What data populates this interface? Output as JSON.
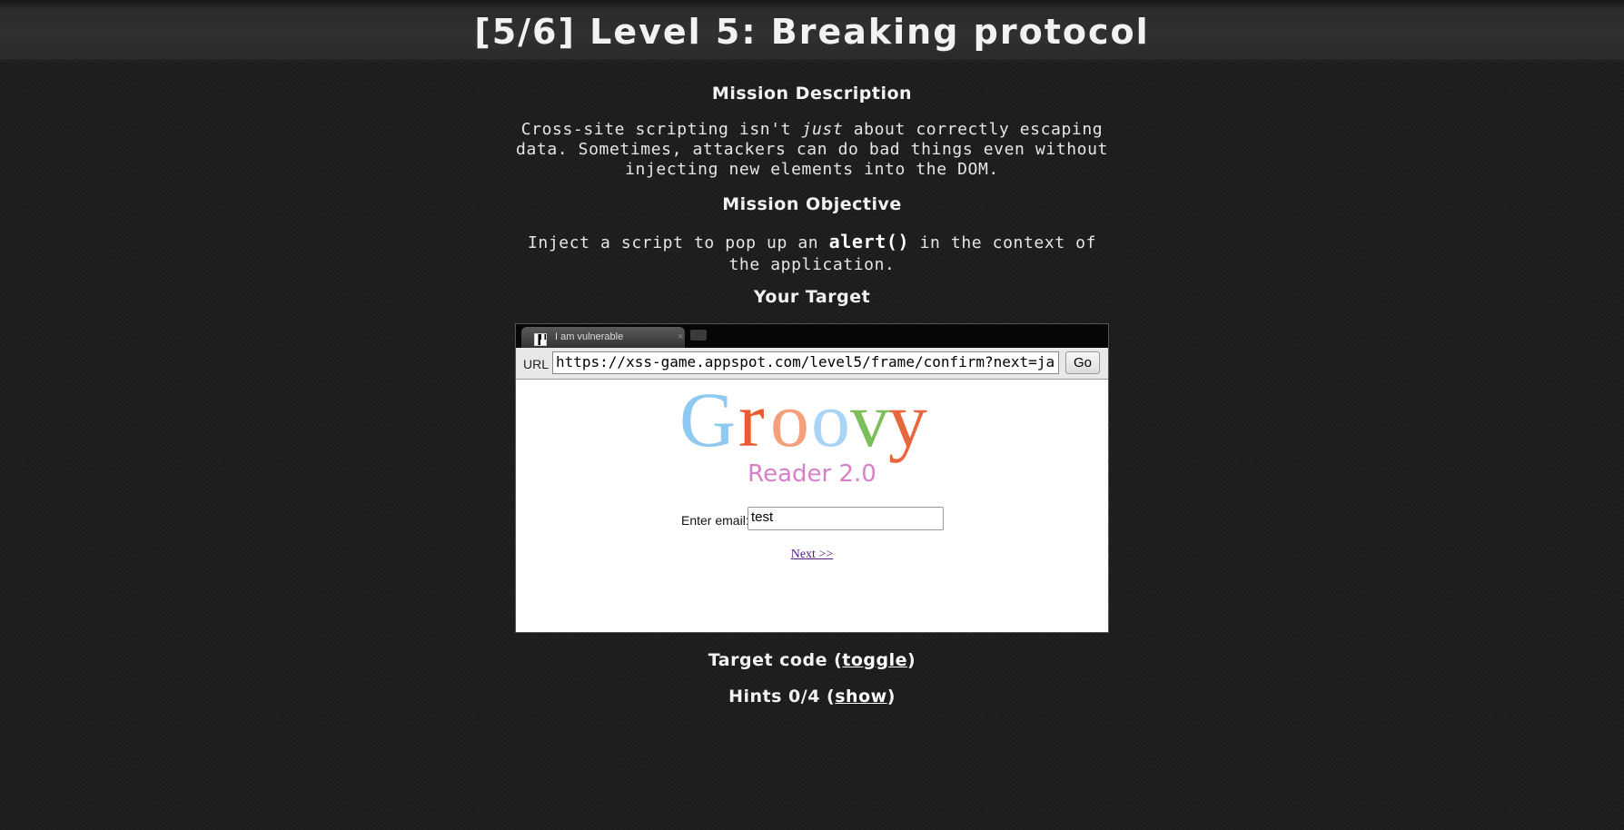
{
  "page": {
    "title": "[5/6]  Level 5: Breaking protocol"
  },
  "mission": {
    "description_heading": "Mission Description",
    "description_part1": "Cross-site scripting isn't ",
    "description_emphasis": "just",
    "description_part2": " about correctly escaping data. Sometimes, attackers can do bad things even without injecting new elements into the DOM.",
    "objective_heading": "Mission Objective",
    "objective_part1": "Inject a script to pop up an ",
    "objective_code": "alert()",
    "objective_part2": " in the context of the application.",
    "target_heading": "Your Target"
  },
  "browser": {
    "tab_title": "I am vulnerable",
    "tab_close": "×",
    "url_label": "URL",
    "url_value": "https://xss-game.appspot.com/level5/frame/confirm?next=ja",
    "go_label": "Go"
  },
  "frame": {
    "logo_title": "Groovy",
    "logo_subtitle": "Reader 2.0",
    "email_label": "Enter email:",
    "email_value": "test",
    "next_link": "Next >>"
  },
  "footer": {
    "target_code_prefix": "Target code (",
    "target_code_link": "toggle",
    "target_code_suffix": ")",
    "hints_prefix": "Hints 0/4 (",
    "hints_link": "show",
    "hints_suffix": ")"
  },
  "colors": {
    "background": "#1e1e1e",
    "text": "#ececec",
    "logo_g": "#8ec9f2",
    "logo_r": "#e85c30",
    "logo_o1": "#f4a07a",
    "logo_o2": "#a8d4f5",
    "logo_v": "#7cbf5a",
    "logo_y": "#e8673c",
    "logo_subtitle": "#d780c8",
    "visited_link": "#551a8b"
  }
}
